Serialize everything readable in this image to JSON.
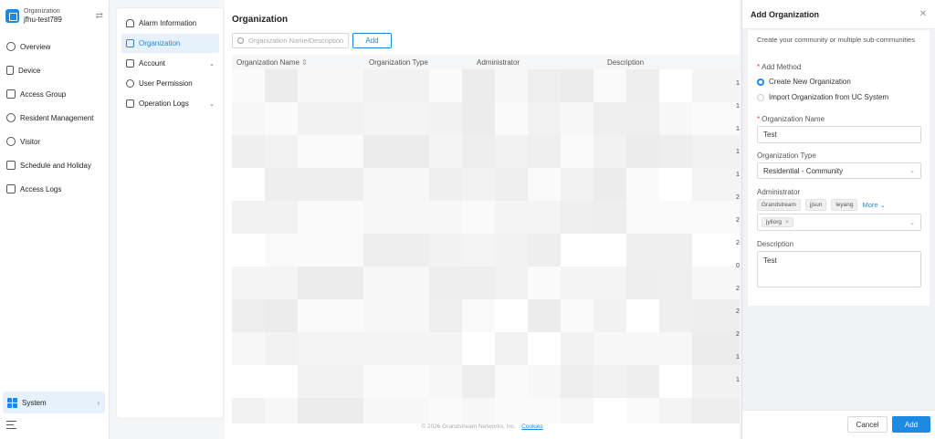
{
  "sidebar": {
    "org_label": "Organization",
    "org_name": "jfhu-test789",
    "items": [
      {
        "label": "Overview",
        "icon": "overview-icon"
      },
      {
        "label": "Device",
        "icon": "device-icon"
      },
      {
        "label": "Access Group",
        "icon": "access-group-icon"
      },
      {
        "label": "Resident Management",
        "icon": "resident-icon"
      },
      {
        "label": "Visitor",
        "icon": "visitor-icon"
      },
      {
        "label": "Schedule and Holiday",
        "icon": "calendar-icon"
      },
      {
        "label": "Access Logs",
        "icon": "access-logs-icon"
      }
    ],
    "system_label": "System"
  },
  "submenu": {
    "items": [
      {
        "label": "Alarm Information",
        "icon": "bell-icon"
      },
      {
        "label": "Organization",
        "icon": "organization-icon",
        "active": true
      },
      {
        "label": "Account",
        "icon": "account-icon",
        "expandable": true
      },
      {
        "label": "User Permission",
        "icon": "user-permission-icon"
      },
      {
        "label": "Operation Logs",
        "icon": "operation-logs-icon",
        "expandable": true
      }
    ]
  },
  "main": {
    "title": "Organization",
    "search_placeholder": "Organization Name/Description",
    "add_label": "Add",
    "columns": [
      "Organization Name",
      "Organization Type",
      "Administrator",
      "Description"
    ],
    "sort_icon": "sort-icon",
    "side_digits": [
      "1",
      "1",
      "1",
      "1",
      "1",
      "2",
      "2",
      "2",
      "0",
      "2",
      "2",
      "2",
      "1",
      "1"
    ],
    "footer_text": "© 2026 Grandstream Networks, Inc.",
    "footer_link": "Cookies"
  },
  "drawer": {
    "title": "Add Organization",
    "description": "Create your community or multiple sub-communities",
    "add_method_label": "Add Method",
    "option_new": "Create New Organization",
    "option_import": "Import Organization from UC System",
    "selected_method": "Create New Organization",
    "org_name_label": "Organization Name",
    "org_name_value": "Test",
    "org_type_label": "Organization Type",
    "org_type_value": "Residential - Community",
    "admin_label": "Administrator",
    "admin_tags": [
      "Grandstream",
      "jjsun",
      "leyang"
    ],
    "more_label": "More",
    "selected_admin": "jyliorg",
    "description_label": "Description",
    "description_value": "Test",
    "cancel_label": "Cancel",
    "add_label": "Add"
  },
  "colors": {
    "accent": "#1e88e5",
    "active_bg": "#e6f1fc",
    "required": "#e53935"
  }
}
